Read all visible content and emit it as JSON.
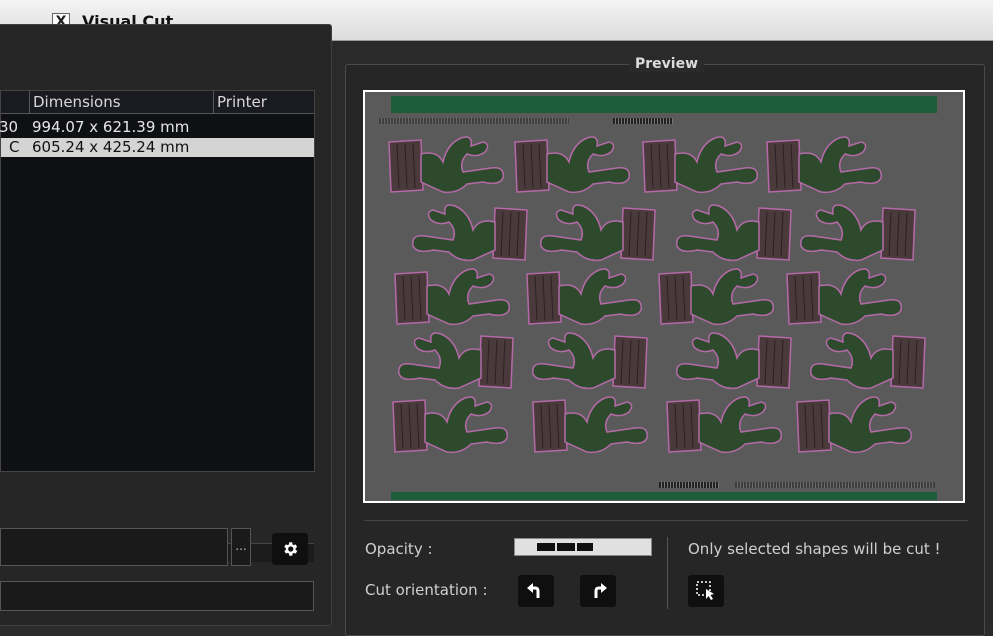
{
  "window": {
    "title": "Visual Cut",
    "app_icon": "x-window-icon"
  },
  "job_table": {
    "columns": [
      "Dimensions",
      "Printer"
    ],
    "rows": [
      {
        "id_fragment": "30",
        "dimensions": "994.07 x 621.39 mm",
        "printer": "",
        "selected": false
      },
      {
        "id_fragment": "C",
        "dimensions": "605.24 x 425.24 mm",
        "printer": "",
        "selected": true
      }
    ],
    "horizontal_scroll_fraction": 0.71
  },
  "file_field": {
    "value": "",
    "browse_label": "..."
  },
  "settings_button_icon": "gear-icon",
  "preview": {
    "legend": "Preview",
    "colors": {
      "background": "#5a5a5a",
      "strip": "#1c5e3a",
      "cactus": "#2d4a2c",
      "pot": "#4a3a3c",
      "outline": "#b56aa8"
    }
  },
  "controls": {
    "opacity_label": "Opacity :",
    "cut_orientation_label": "Cut orientation :",
    "notice": "Only selected shapes will be cut !",
    "rotate_left_icon": "rotate-left-icon",
    "rotate_right_icon": "rotate-right-icon",
    "select_shapes_icon": "select-shapes-icon"
  }
}
